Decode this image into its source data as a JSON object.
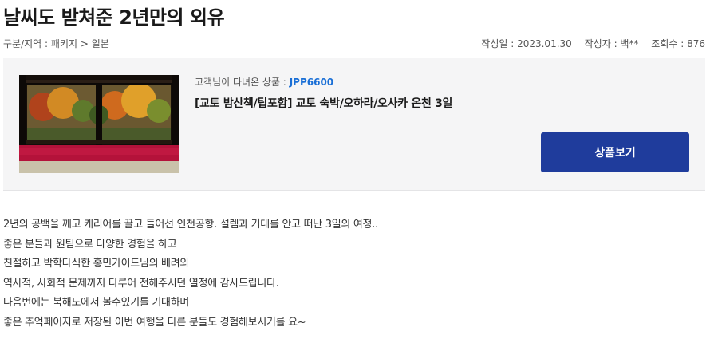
{
  "review_title": "날씨도 받쳐준 2년만의 외유",
  "category": {
    "label": "구분/지역",
    "separator": ":",
    "path": "패키지 > 일본"
  },
  "meta": {
    "date_label": "작성일",
    "date": "2023.01.30",
    "author_label": "작성자",
    "author": "백**",
    "views_label": "조회수",
    "views": "876"
  },
  "product": {
    "visited_label": "고객님이 다녀온 상품 :",
    "code": "JPP6600",
    "name": "[교토 밤산책/팁포함] 교토 숙박/오하라/오사카 온천 3일",
    "button_label": "상품보기",
    "thumbnail": "kyoto-temple-autumn-garden-photo"
  },
  "body_lines": [
    "2년의 공백을 깨고 캐리어를 끌고 들어선 인천공항. 설렘과 기대를 안고 떠난 3일의 여정..",
    "좋은 분들과 원팀으로 다양한 경험을 하고",
    "친절하고 박학다식한 홍민가이드님의 배려와",
    "역사적, 사회적 문제까지 다루어 전해주시던 열정에 감사드립니다.",
    "다음번에는 북해도에서 볼수있기를 기대하며",
    "좋은 추억페이지로 저장된 이번 여행을 다른 분들도 경험해보시기를 요~"
  ],
  "colors": {
    "accent_blue": "#1f3c9c",
    "code_blue": "#1a6fd6",
    "box_bg": "#f5f5f6"
  }
}
